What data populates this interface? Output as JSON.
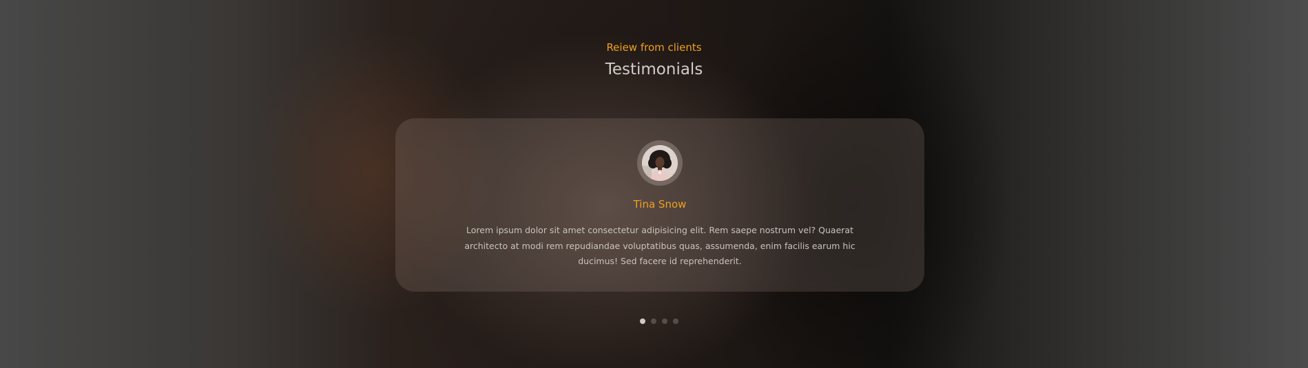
{
  "section": {
    "subtitle": "Reiew from clients",
    "title": "Testimonials"
  },
  "testimonial": {
    "avatar_icon": "person-avatar",
    "name": "Tina Snow",
    "text": "Lorem ipsum dolor sit amet consectetur adipisicing elit. Rem saepe nostrum vel? Quaerat architecto at modi rem repudiandae voluptatibus quas, assumenda, enim facilis earum hic ducimus! Sed facere id reprehenderit."
  },
  "pagination": {
    "count": 4,
    "active_index": 0
  },
  "colors": {
    "accent": "#f0a020",
    "title": "#d2cdca",
    "text": "#c9c3bf"
  }
}
